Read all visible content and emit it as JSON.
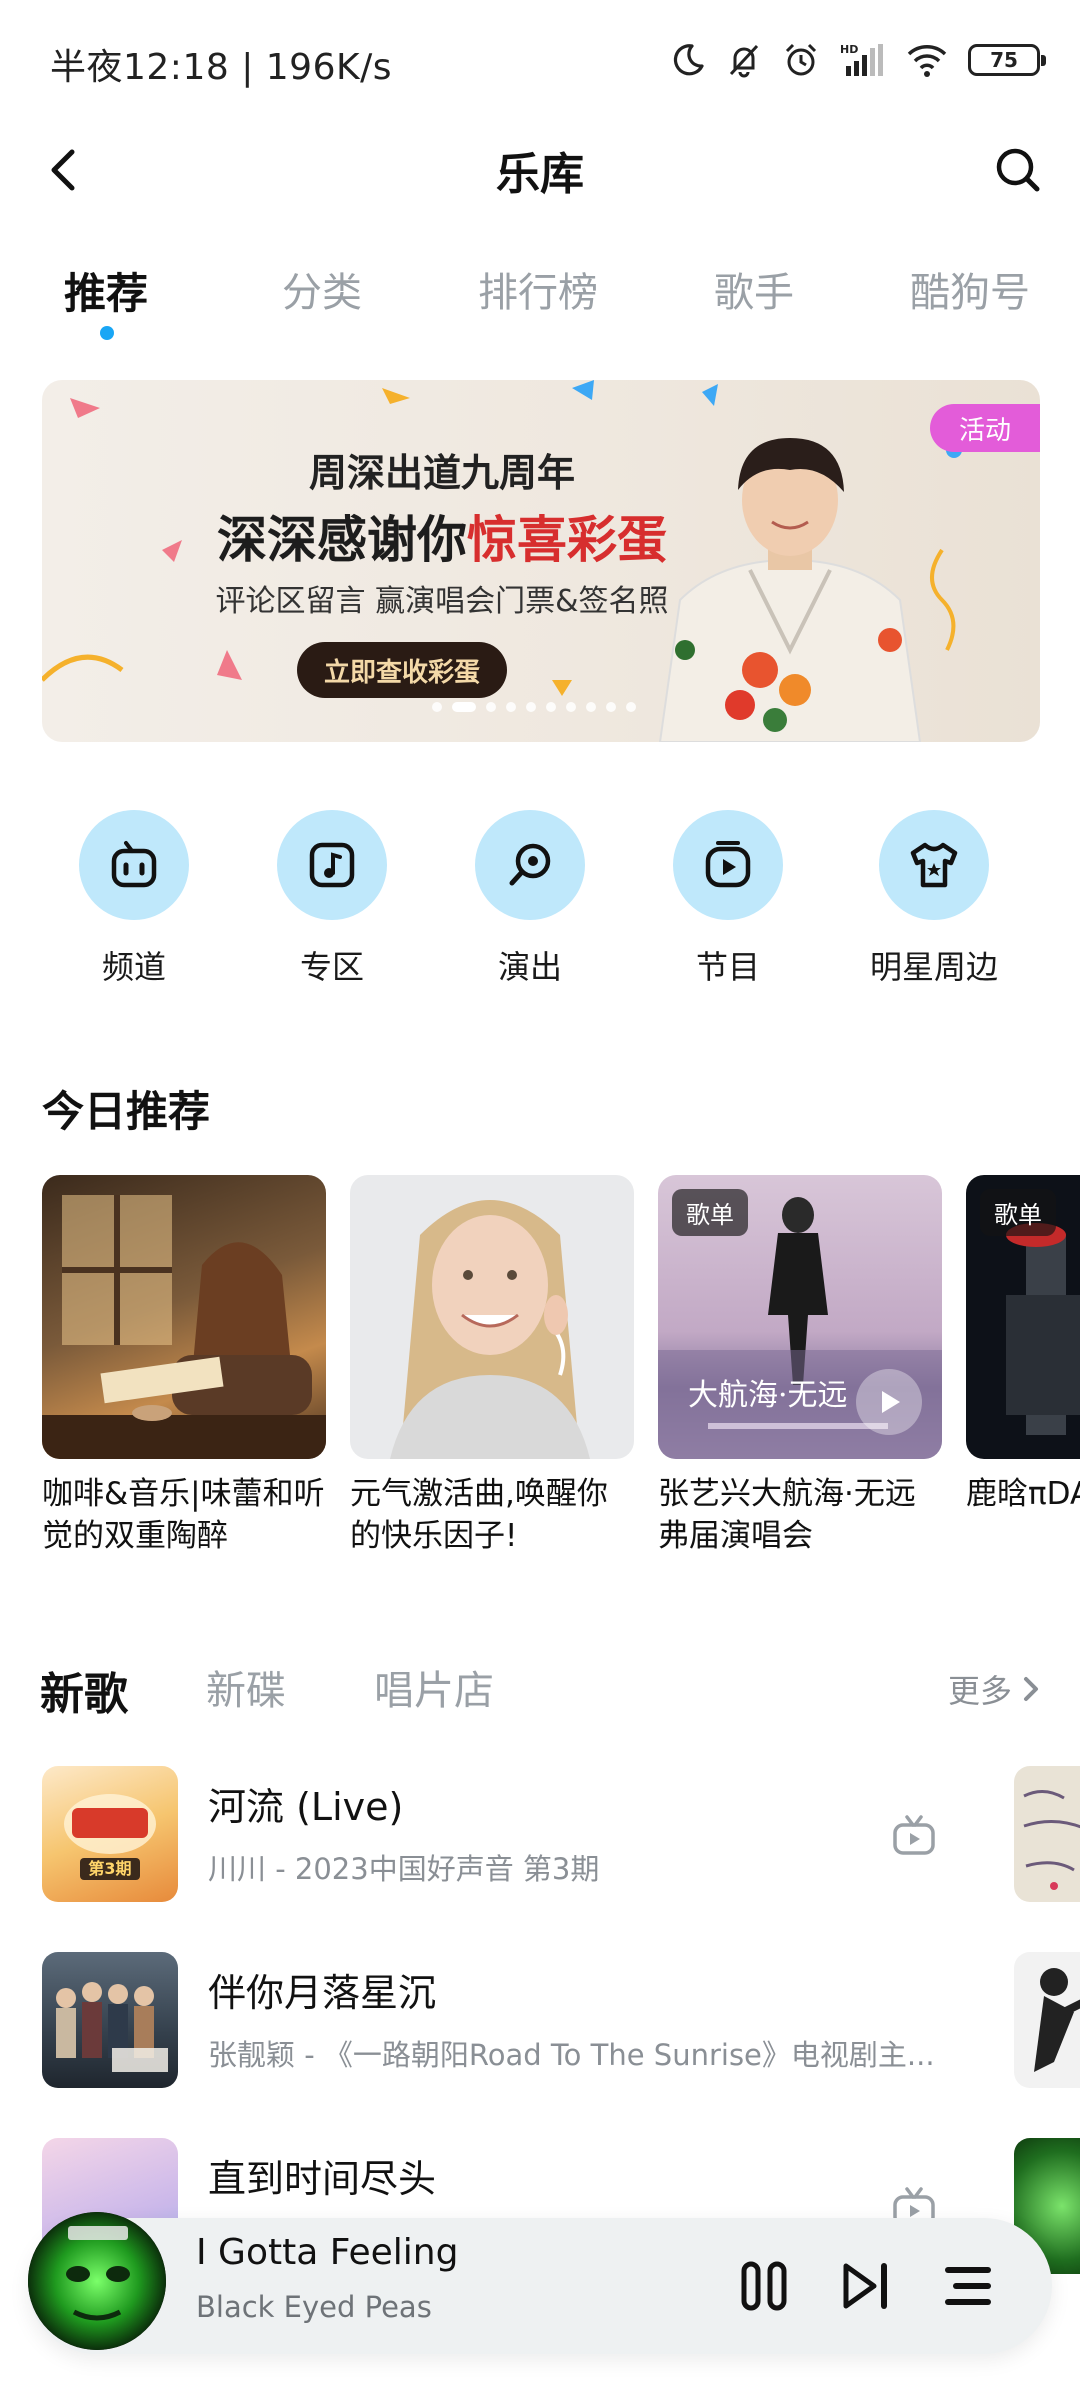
{
  "status_bar": {
    "time": "半夜12:18 | 196K/s",
    "battery": "75"
  },
  "header": {
    "title": "乐库"
  },
  "tabs": [
    {
      "label": "推荐",
      "active": true
    },
    {
      "label": "分类",
      "active": false
    },
    {
      "label": "排行榜",
      "active": false
    },
    {
      "label": "歌手",
      "active": false
    },
    {
      "label": "酷狗号",
      "active": false
    }
  ],
  "banner": {
    "badge": "活动",
    "line1": "周深出道九周年",
    "line2_prefix": "深深感谢你",
    "line2_accent": "惊喜彩蛋",
    "line3": "评论区留言 赢演唱会门票&签名照",
    "cta": "立即查收彩蛋",
    "accent_color": "#d72e2e"
  },
  "quick_access": [
    {
      "label": "频道",
      "icon": "channel-icon"
    },
    {
      "label": "专区",
      "icon": "music-note-icon"
    },
    {
      "label": "演出",
      "icon": "microphone-icon"
    },
    {
      "label": "节目",
      "icon": "program-icon"
    },
    {
      "label": "明星周边",
      "icon": "tshirt-icon"
    }
  ],
  "today": {
    "title": "今日推荐",
    "cards": [
      {
        "caption": "咖啡&音乐|味蕾和听觉的双重陶醉",
        "tag": ""
      },
      {
        "caption": "元气激活曲,唤醒你的快乐因子!",
        "tag": ""
      },
      {
        "caption": "张艺兴大航海·无远弗届演唱会",
        "tag": "歌单",
        "cover_text": "大航海·无远"
      },
      {
        "caption": "鹿晗πDA会",
        "tag": "歌单"
      }
    ]
  },
  "new_songs": {
    "tabs": [
      {
        "label": "新歌",
        "active": true
      },
      {
        "label": "新碟",
        "active": false
      },
      {
        "label": "唱片店",
        "active": false
      }
    ],
    "more": "更多",
    "songs": [
      {
        "title": "河流 (Live)",
        "subtitle": "川川 - 2023中国好声音 第3期",
        "cover_text": "第3期"
      },
      {
        "title": "伴你月落星沉",
        "subtitle": "张靓颖 - 《一路朝阳Road To The Sunrise》电视剧主..."
      },
      {
        "title": "直到时间尽头",
        "subtitle": ""
      }
    ]
  },
  "player": {
    "title": "I Gotta Feeling",
    "artist": "Black Eyed Peas"
  }
}
